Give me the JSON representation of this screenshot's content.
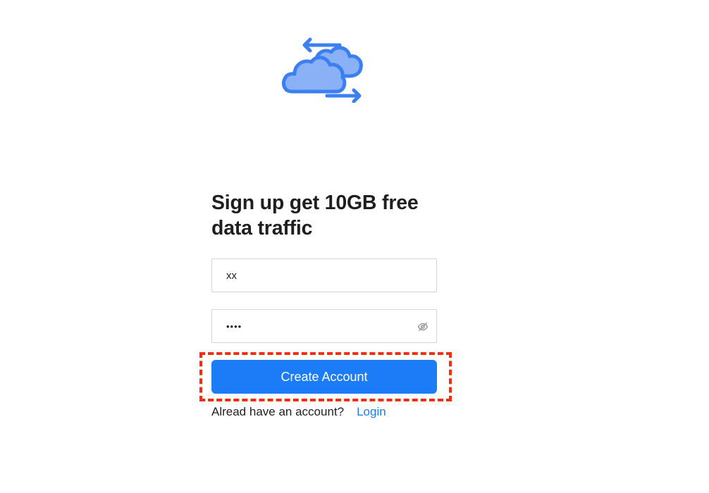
{
  "brand": {
    "logo_icon": "cloud-sync-icon",
    "primary_color": "#1c7bf6",
    "logo_fill_color": "#8ab1f5",
    "logo_stroke_color": "#3b7ff2"
  },
  "signup": {
    "headline": "Sign up get 10GB free data traffic",
    "username_value": "xx",
    "password_value": "••••",
    "password_toggle_icon": "eye-slash-icon",
    "create_button_label": "Create Account",
    "existing_account_text": "Alread have an account?",
    "login_link_label": "Login"
  },
  "annotation": {
    "highlight_color": "#ef2f12"
  }
}
